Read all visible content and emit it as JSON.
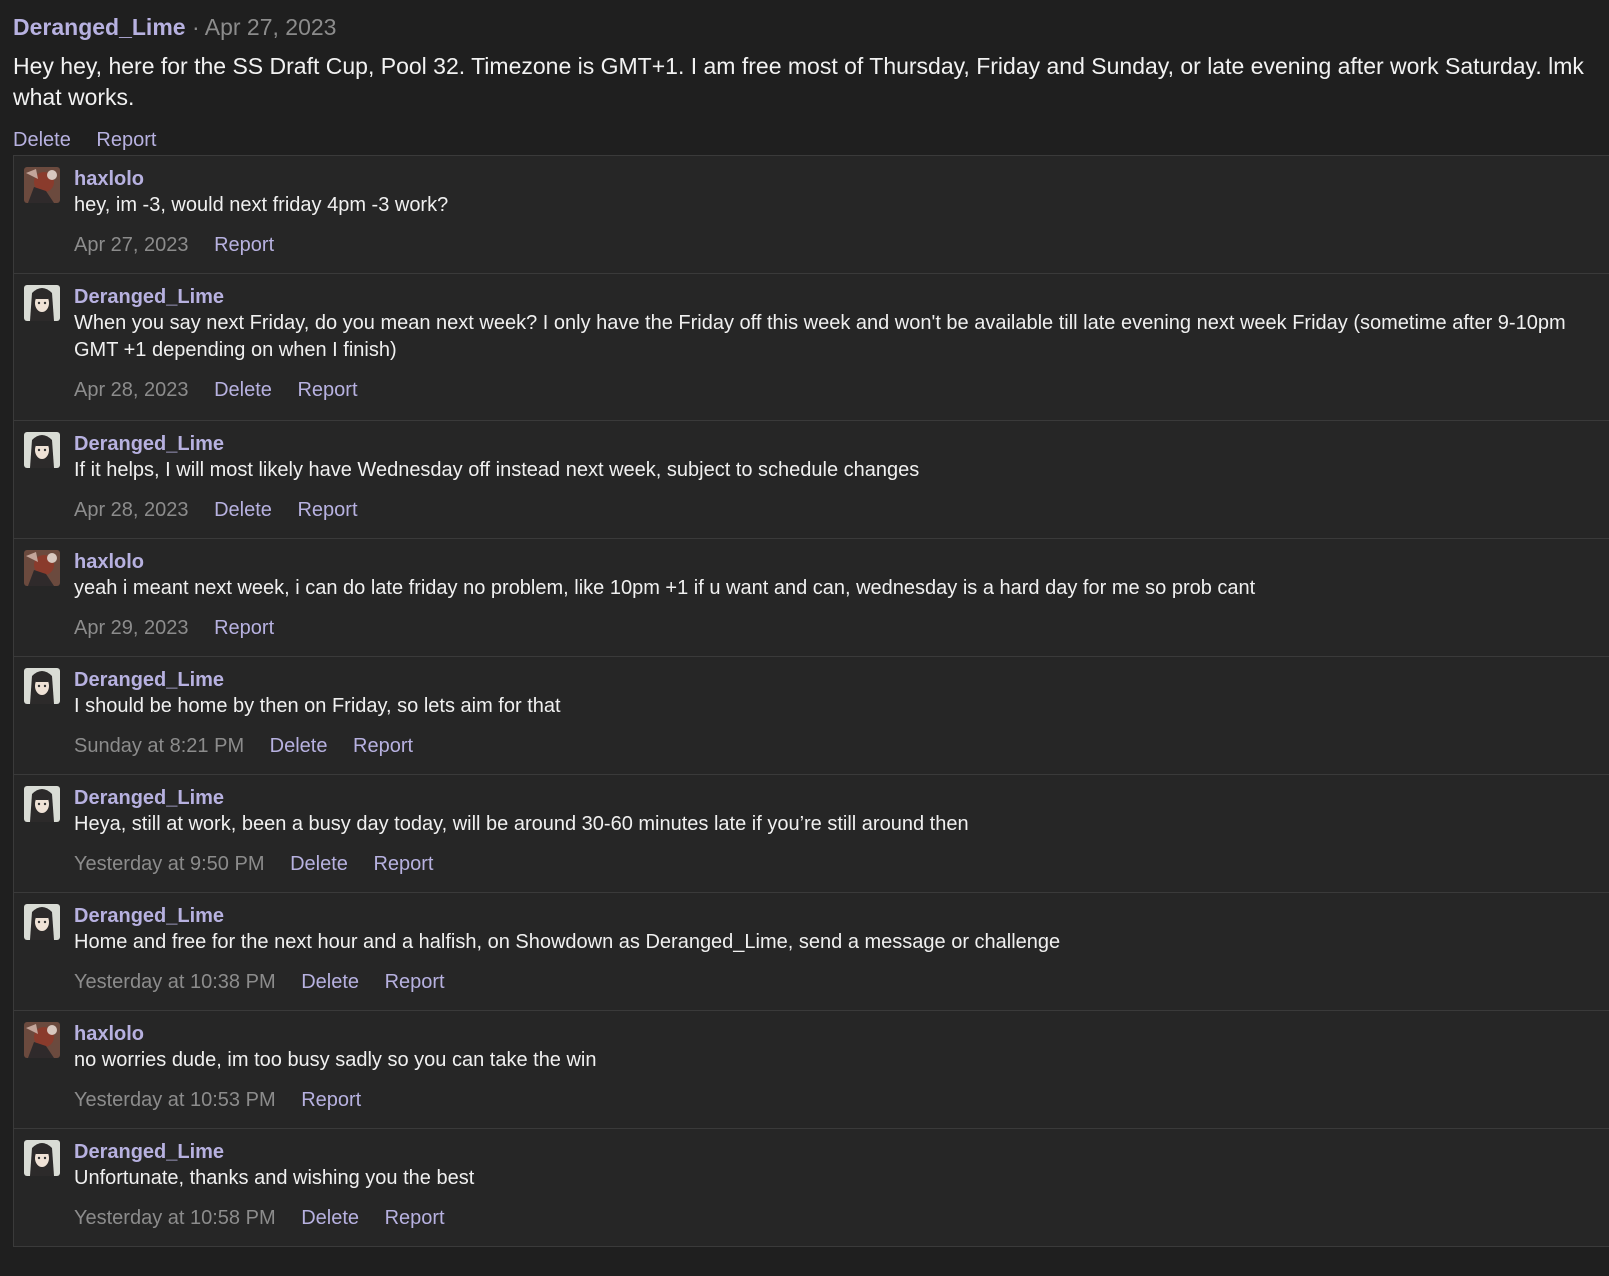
{
  "post": {
    "author": "Deranged_Lime",
    "separator": "·",
    "date": "Apr 27, 2023",
    "body": "Hey hey, here for the SS Draft Cup, Pool 32. Timezone is GMT+1. I am free most of Thursday, Friday and Sunday, or late evening after work Saturday. lmk what works.",
    "actions": [
      "Delete",
      "Report"
    ]
  },
  "comments": [
    {
      "author": "haxlolo",
      "avatar_icon": "haxlolo-avatar",
      "body": "hey, im -3, would next friday 4pm -3 work?",
      "date": "Apr 27, 2023",
      "delete_label": "",
      "report_label": "Report"
    },
    {
      "author": "Deranged_Lime",
      "avatar_icon": "deranged-lime-avatar",
      "body": "When you say next Friday, do you mean next week? I only have the Friday off this week and won't be available till late evening next week Friday (sometime after 9-10pm GMT +1 depending on when I finish)",
      "date": "Apr 28, 2023",
      "delete_label": "Delete",
      "report_label": "Report"
    },
    {
      "author": "Deranged_Lime",
      "avatar_icon": "deranged-lime-avatar",
      "body": "If it helps, I will most likely have Wednesday off instead next week, subject to schedule changes",
      "date": "Apr 28, 2023",
      "delete_label": "Delete",
      "report_label": "Report"
    },
    {
      "author": "haxlolo",
      "avatar_icon": "haxlolo-avatar",
      "body": "yeah i meant next week, i can do late friday no problem, like 10pm +1 if u want and can, wednesday is a hard day for me so prob cant",
      "date": "Apr 29, 2023",
      "delete_label": "",
      "report_label": "Report"
    },
    {
      "author": "Deranged_Lime",
      "avatar_icon": "deranged-lime-avatar",
      "body": "I should be home by then on Friday, so lets aim for that",
      "date": "Sunday at 8:21 PM",
      "delete_label": "Delete",
      "report_label": "Report"
    },
    {
      "author": "Deranged_Lime",
      "avatar_icon": "deranged-lime-avatar",
      "body": "Heya, still at work, been a busy day today, will be around 30-60 minutes late if you’re still around then",
      "date": "Yesterday at 9:50 PM",
      "delete_label": "Delete",
      "report_label": "Report"
    },
    {
      "author": "Deranged_Lime",
      "avatar_icon": "deranged-lime-avatar",
      "body": "Home and free for the next hour and a halfish, on Showdown as Deranged_Lime, send a message or challenge",
      "date": "Yesterday at 10:38 PM",
      "delete_label": "Delete",
      "report_label": "Report"
    },
    {
      "author": "haxlolo",
      "avatar_icon": "haxlolo-avatar",
      "body": "no worries dude, im too busy sadly so you can take the win",
      "date": "Yesterday at 10:53 PM",
      "delete_label": "",
      "report_label": "Report"
    },
    {
      "author": "Deranged_Lime",
      "avatar_icon": "deranged-lime-avatar",
      "body": "Unfortunate, thanks and wishing you the best",
      "date": "Yesterday at 10:58 PM",
      "delete_label": "Delete",
      "report_label": "Report"
    }
  ],
  "colors": {
    "background": "#1f1f1f",
    "comment_background": "#262626",
    "link": "#b7b1e0",
    "muted": "#8c8c8c",
    "border": "#3a3a3a"
  }
}
